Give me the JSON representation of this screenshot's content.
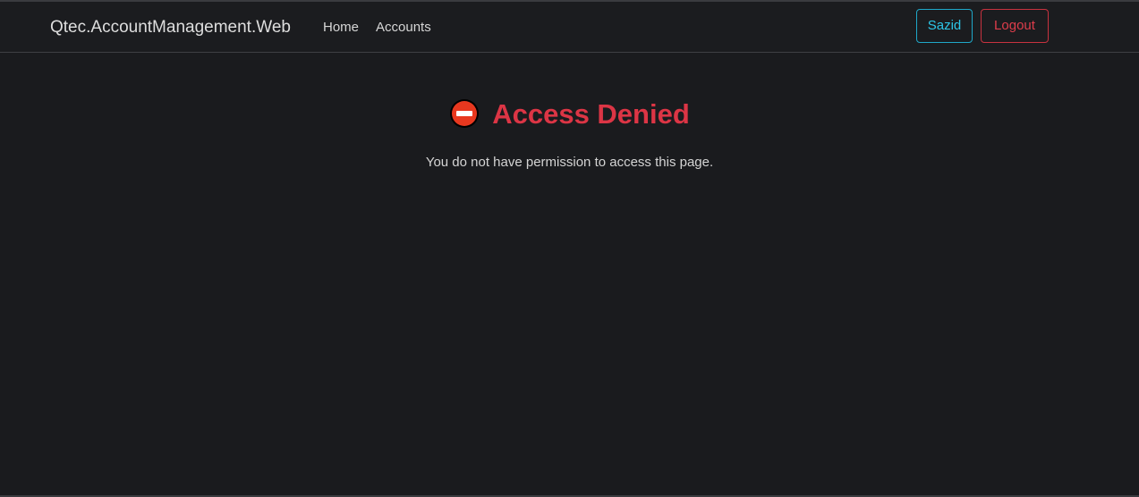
{
  "navbar": {
    "brand": "Qtec.AccountManagement.Web",
    "links": [
      {
        "label": "Home"
      },
      {
        "label": "Accounts"
      }
    ],
    "user_button": "Sazid",
    "logout_button": "Logout"
  },
  "main": {
    "heading": "Access Denied",
    "heading_icon": "no-entry-icon",
    "message": "You do not have permission to access this page."
  },
  "colors": {
    "background": "#1a1b1e",
    "danger": "#dc3545",
    "info": "#2dc6e8"
  }
}
